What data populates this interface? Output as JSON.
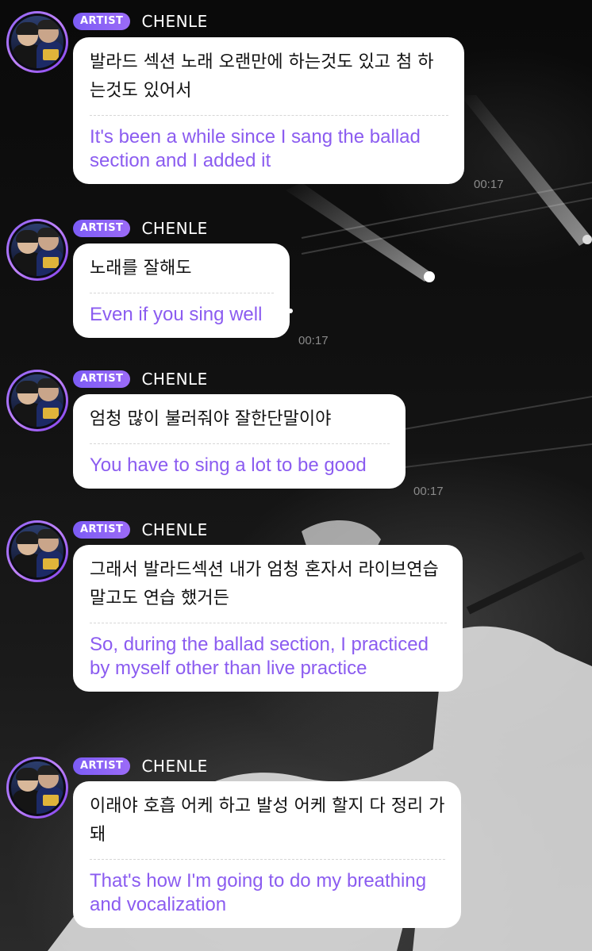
{
  "messages": [
    {
      "badge": "ARTIST",
      "name": "CHENLE",
      "korean": "발라드 섹션 노래 오랜만에 하는것도 있고 첨 하는것도 있어서",
      "english": "It's been a while since I sang the ballad section and I added it",
      "time": "00:17"
    },
    {
      "badge": "ARTIST",
      "name": "CHENLE",
      "korean": "노래를 잘해도",
      "english": "Even if you sing well",
      "time": "00:17"
    },
    {
      "badge": "ARTIST",
      "name": "CHENLE",
      "korean": "엄청 많이 불러줘야 잘한단말이야",
      "english": "You have to sing a lot to be good",
      "time": "00:17"
    },
    {
      "badge": "ARTIST",
      "name": "CHENLE",
      "korean": "그래서 발라드섹션 내가 엄청 혼자서 라이브연습 말고도 연습 했거든",
      "english": "So, during the ballad section, I practiced by myself other than live practice",
      "time": ""
    },
    {
      "badge": "ARTIST",
      "name": "CHENLE",
      "korean": "이래야 호흡 어케 하고 발성 어케 할지 다 정리 가돼",
      "english": "That's how I'm going to do my breathing and vocalization",
      "time": ""
    }
  ],
  "icons": {
    "avatar": "artist-avatar-photo"
  },
  "colors": {
    "badge": "#8b63f6",
    "translation_text": "#8b5cf0",
    "bubble": "#ffffff",
    "timestamp": "#8a8a8a"
  }
}
